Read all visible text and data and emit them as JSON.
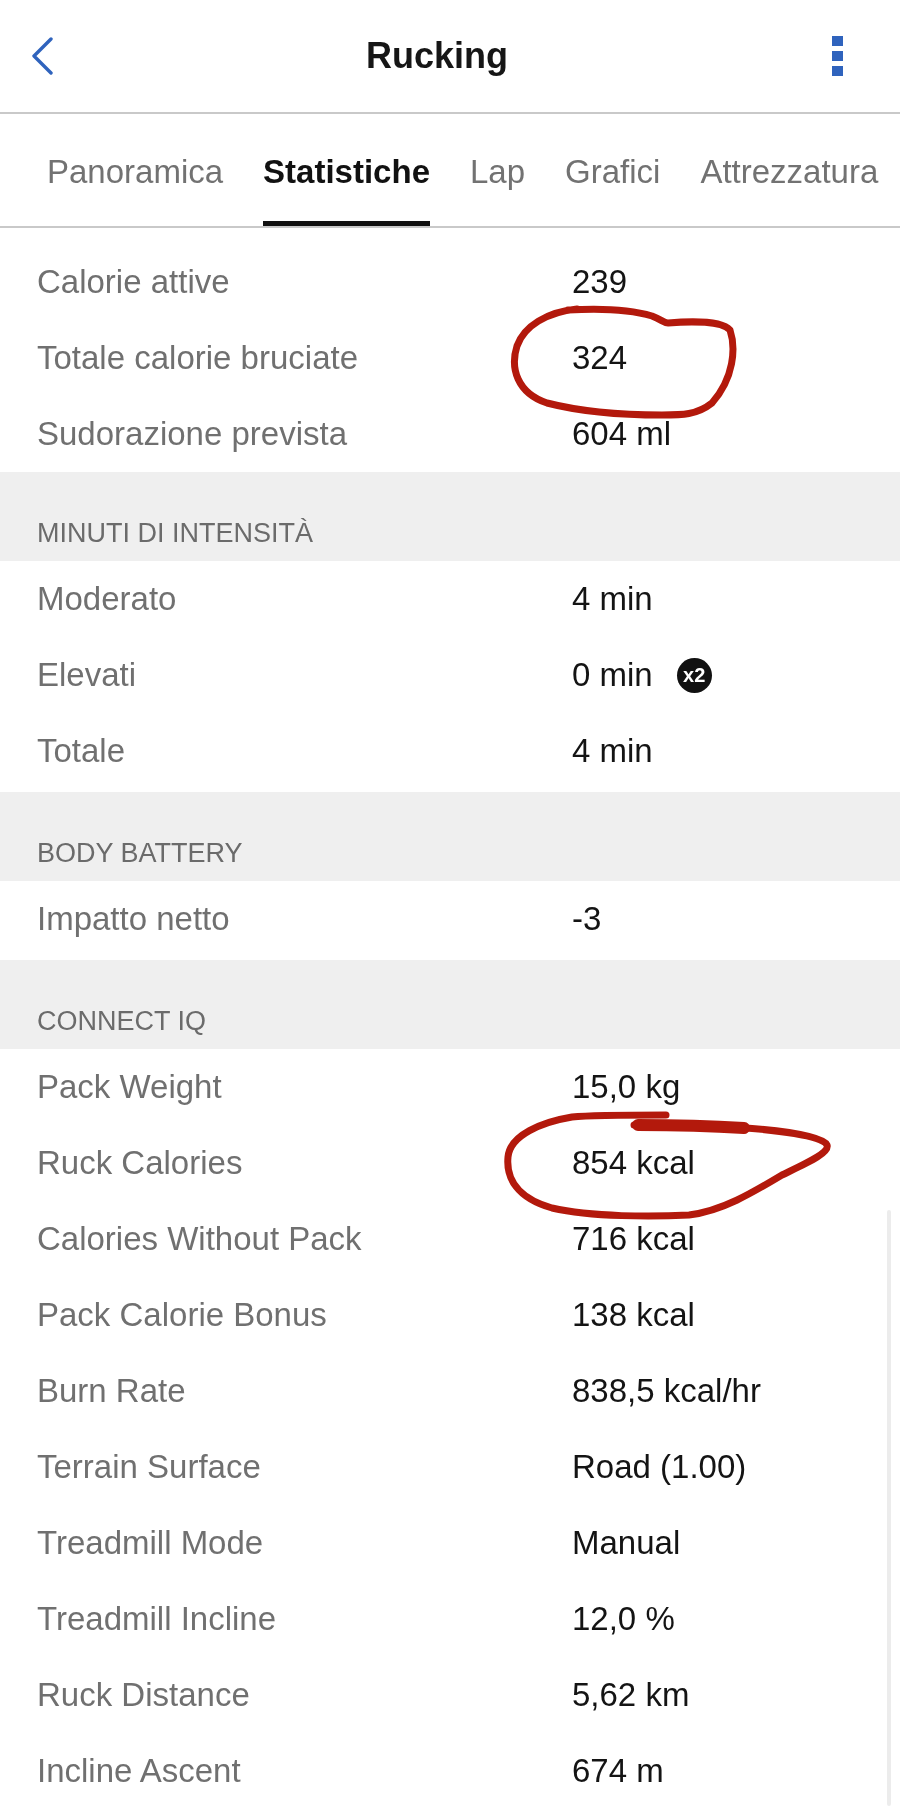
{
  "header": {
    "title": "Rucking"
  },
  "tabs": [
    {
      "label": "Panoramica",
      "selected": false
    },
    {
      "label": "Statistiche",
      "selected": true
    },
    {
      "label": "Lap",
      "selected": false
    },
    {
      "label": "Grafici",
      "selected": false
    },
    {
      "label": "Attrezzatura",
      "selected": false
    }
  ],
  "sections": [
    {
      "rows": [
        {
          "label": "Calorie attive",
          "value": "239",
          "circled": false
        },
        {
          "label": "Totale calorie bruciate",
          "value": "324",
          "circled": true
        },
        {
          "label": "Sudorazione prevista",
          "value": "604 ml",
          "circled": false
        }
      ]
    },
    {
      "title": "MINUTI DI INTENSITÀ",
      "rows": [
        {
          "label": "Moderato",
          "value": "4 min",
          "circled": false
        },
        {
          "label": "Elevati",
          "value": "0 min",
          "badge": "x2",
          "circled": false
        },
        {
          "label": "Totale",
          "value": "4 min",
          "circled": false
        }
      ]
    },
    {
      "title": "BODY BATTERY",
      "rows": [
        {
          "label": "Impatto netto",
          "value": "-3",
          "circled": false
        }
      ]
    },
    {
      "title": "CONNECT IQ",
      "rows": [
        {
          "label": "Pack Weight",
          "value": "15,0 kg",
          "circled": false
        },
        {
          "label": "Ruck Calories",
          "value": "854 kcal",
          "circled": true
        },
        {
          "label": "Calories Without Pack",
          "value": "716 kcal",
          "circled": false
        },
        {
          "label": "Pack Calorie Bonus",
          "value": "138 kcal",
          "circled": false
        },
        {
          "label": "Burn Rate",
          "value": "838,5 kcal/hr",
          "circled": false
        },
        {
          "label": "Terrain Surface",
          "value": "Road (1.00)",
          "circled": false
        },
        {
          "label": "Treadmill Mode",
          "value": "Manual",
          "circled": false
        },
        {
          "label": "Treadmill Incline",
          "value": "12,0 %",
          "circled": false
        },
        {
          "label": "Ruck Distance",
          "value": "5,62 km",
          "circled": false
        },
        {
          "label": "Incline Ascent",
          "value": "674 m",
          "circled": false
        }
      ]
    }
  ]
}
